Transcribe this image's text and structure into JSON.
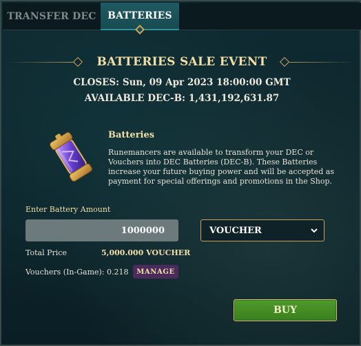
{
  "tabs": [
    {
      "label": "TRANSFER DEC"
    },
    {
      "label": "BATTERIES"
    }
  ],
  "event": {
    "title": "BATTERIES SALE EVENT",
    "closes": "CLOSES: Sun, 09 Apr 2023 18:00:00 GMT",
    "available": "AVAILABLE DEC-B: 1,431,192,631.87"
  },
  "product": {
    "name": "Batteries",
    "description": "Runemancers are available to transform your DEC or Vouchers into DEC Batteries (DEC-B). These Batteries increase your future buying power and will be accepted as payment for special offerings and promotions in the Shop.",
    "icon": "battery-icon"
  },
  "form": {
    "amount_label": "Enter Battery Amount",
    "amount_value": "1000000",
    "currency_selected": "VOUCHER",
    "total_label": "Total Price",
    "total_value": "5,000.000 VOUCHER",
    "vouchers_label": "Vouchers (In-Game): 0.218",
    "manage_label": "MANAGE",
    "buy_label": "BUY"
  },
  "colors": {
    "accent_gold": "#c9a45a",
    "title_gold": "#f1dfa6",
    "tab_active": "#1f5a60",
    "buy_green": "#4e9a2a",
    "manage_purple": "#4b2a5c"
  }
}
